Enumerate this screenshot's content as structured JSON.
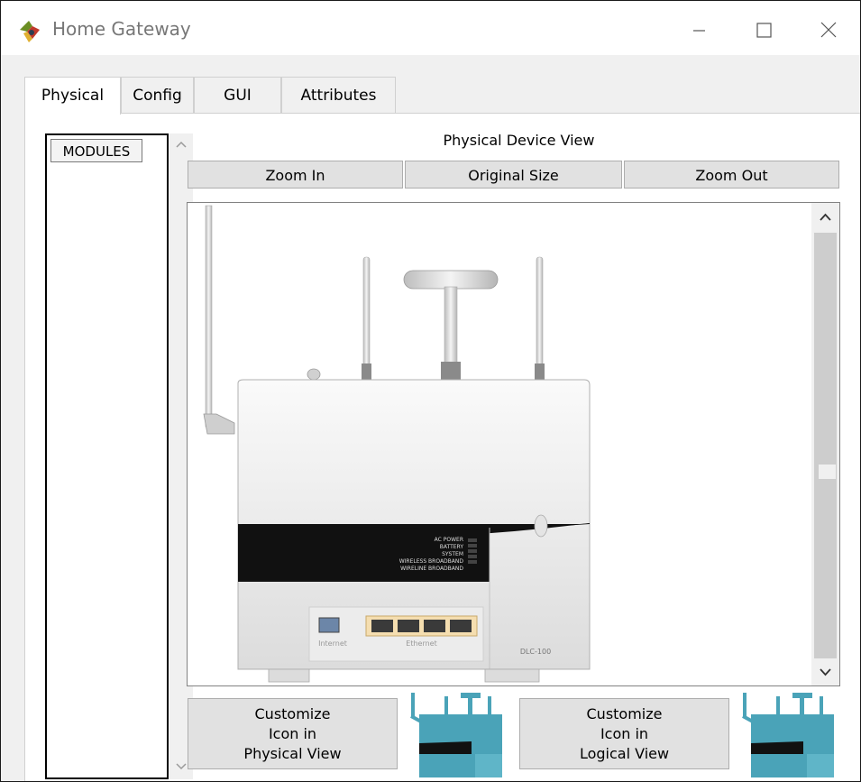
{
  "window": {
    "title": "Home Gateway",
    "icon": "packet-tracer-icon"
  },
  "window_controls": {
    "minimize_icon": "minimize-icon",
    "maximize_icon": "maximize-icon",
    "close_icon": "close-icon"
  },
  "tabs": [
    {
      "label": "Physical",
      "active": true
    },
    {
      "label": "Config",
      "active": false
    },
    {
      "label": "GUI",
      "active": false
    },
    {
      "label": "Attributes",
      "active": false
    }
  ],
  "modules": {
    "items": [
      "MODULES"
    ]
  },
  "physical_view": {
    "heading": "Physical Device View",
    "zoom_in_label": "Zoom In",
    "original_size_label": "Original Size",
    "zoom_out_label": "Zoom Out"
  },
  "device": {
    "port_internet_label": "Internet",
    "port_ethernet_label": "Ethernet",
    "model_label": "DLC-100",
    "leds": [
      "AC POWER",
      "BATTERY",
      "SYSTEM",
      "WIRELESS BROADBAND",
      "WIRELINE BROADBAND"
    ],
    "body_color": "#e6e6e6",
    "accent_color": "#111111",
    "ethernet_port_color": "#f5deb0"
  },
  "customize": {
    "physical_lines": [
      "Customize",
      "Icon in",
      "Physical View"
    ],
    "logical_lines": [
      "Customize",
      "Icon in",
      "Logical View"
    ],
    "icon_color": "#4aa3b8"
  }
}
